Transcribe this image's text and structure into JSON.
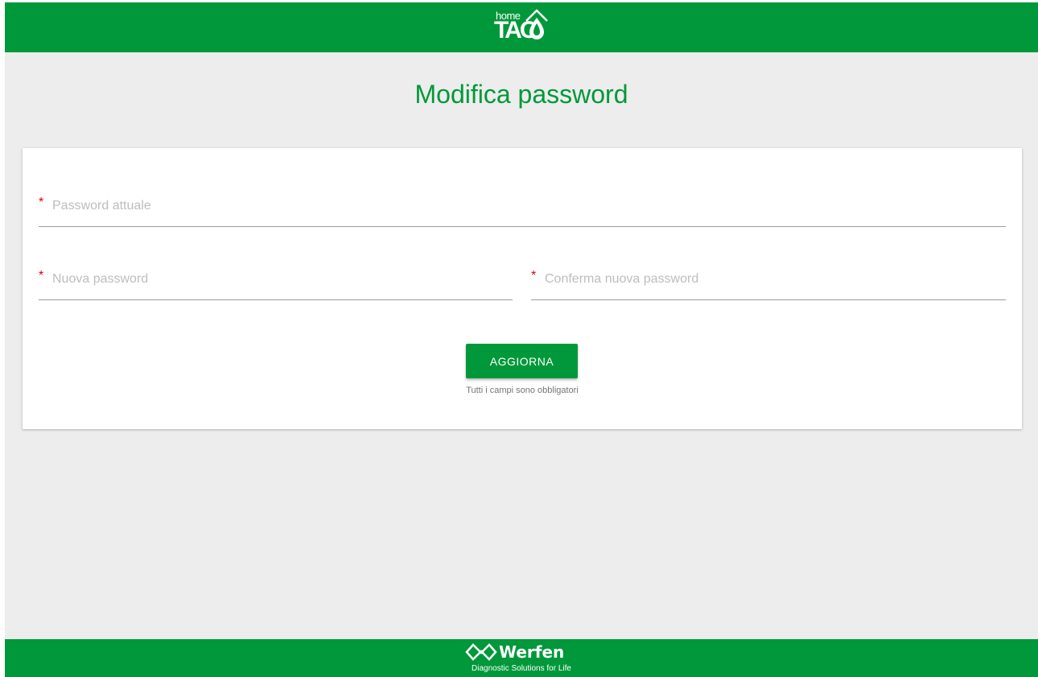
{
  "brand": {
    "logo_small": "home",
    "logo_big": "TAO",
    "color": "#00983a"
  },
  "page": {
    "title": "Modifica password"
  },
  "form": {
    "required_mark": "*",
    "current_password": {
      "placeholder": "Password attuale",
      "value": ""
    },
    "new_password": {
      "placeholder": "Nuova password",
      "value": ""
    },
    "confirm_password": {
      "placeholder": "Conferma nuova password",
      "value": ""
    },
    "submit_label": "AGGIORNA",
    "hint": "Tutti i campi sono obbligatori"
  },
  "footer": {
    "company": "Werfen",
    "tagline": "Diagnostic Solutions for Life",
    "logo_icon": "werfen-diamond-icon"
  }
}
